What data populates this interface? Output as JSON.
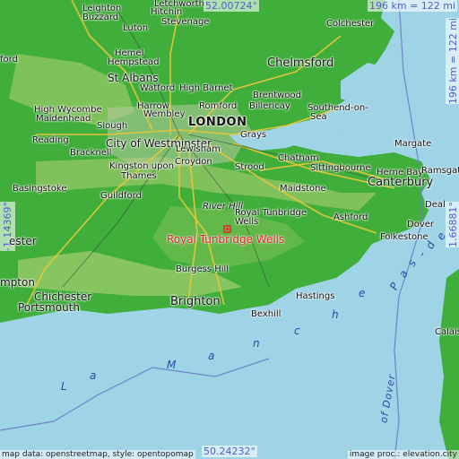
{
  "coords": {
    "top_lat": "52.00724°",
    "bottom_lat": "50.24232°",
    "left_lon": "-1.14369°",
    "right_lon": "1.66881°",
    "scale_horizontal": "196 km = 122 mi",
    "scale_vertical": "196 km = 122 mi"
  },
  "places": {
    "london": "LONDON",
    "westminster": "City of Westminster",
    "target": "Royal Tunbridge Wells",
    "leighton": "Leighton",
    "buzzard": "Buzzard",
    "letchworth": "Letchworth",
    "hitchin": "Hitchin",
    "stevenage": "Stevenage",
    "luton": "Luton",
    "hemel": "Hemel",
    "hempstead": "Hempstead",
    "st_albans": "St Albans",
    "watford": "Watford",
    "high_barnet": "High Barnet",
    "high_wycombe": "High Wycombe",
    "maidenhead": "Maidenhead",
    "harrow": "Harrow",
    "wembley": "Wembley",
    "romford": "Romford",
    "brentwood": "Brentwood",
    "billericay": "Billericay",
    "chelmsford": "Chelmsford",
    "colchester": "Colchester",
    "southend": "Southend-on-",
    "southend_sea": "Sea",
    "reading": "Reading",
    "slough": "Slough",
    "bracknell": "Bracknell",
    "kingston": "Kingston upon",
    "thames": "Thames",
    "lewisham": "Lewisham",
    "croydon": "Croydon",
    "grays": "Grays",
    "chatham": "Chatham",
    "strood": "Strood",
    "sittingbourne": "Sittingbourne",
    "herne_bay": "Herne Bay",
    "margate": "Margate",
    "ramsgate": "Ramsgate",
    "canterbury": "Canterbury",
    "maidstone": "Maidstone",
    "basingstoke": "Basingstoke",
    "guildford": "Guildford",
    "river_hill": "River Hill",
    "royal_tunbridge": "Royal Tunbridge",
    "wells": "Wells",
    "ashford": "Ashford",
    "deal": "Deal",
    "dover": "Dover",
    "folkestone": "Folkestone",
    "winchester_partial": "ester",
    "southampton_partial": "mpton",
    "chichester": "Chichester",
    "portsmouth": "Portsmouth",
    "burgess_hill": "Burgess Hill",
    "brighton": "Brighton",
    "hastings": "Hastings",
    "bexhill": "Bexhill",
    "oxford_partial": "ford",
    "letch_partial_leighton_top": "h",
    "calais_partial": "Calais"
  },
  "sea_labels": {
    "la_manche": [
      "L",
      "a",
      "M",
      "a",
      "n",
      "c",
      "h",
      "e"
    ],
    "pas_de": [
      "P",
      "a",
      "s",
      "-",
      "d",
      "e"
    ],
    "strait": "of Dover"
  },
  "footer": {
    "left": "map data: openstreetmap, style: opentopomap",
    "right": "image proc.: elevation.city"
  },
  "colors": {
    "sea": "#9fd3e6",
    "lowland": "#3fae3a",
    "hills": "#c9d58a",
    "target": "#e8202a",
    "coord_text": "#4a5fd0"
  }
}
